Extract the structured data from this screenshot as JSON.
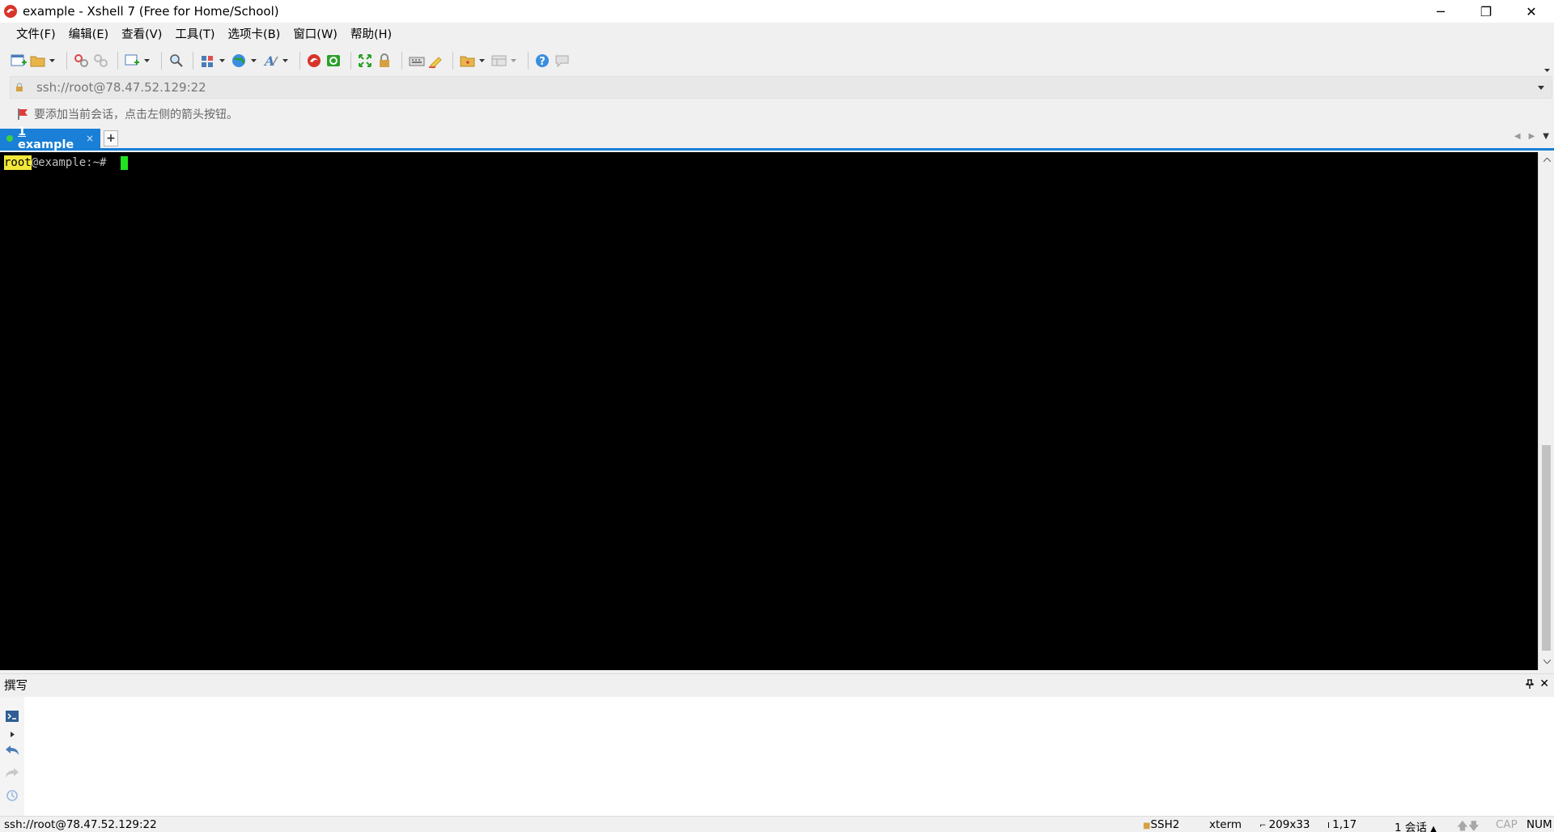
{
  "window": {
    "title": "example - Xshell 7 (Free for Home/School)",
    "icon": "xshell-logo-icon",
    "controls": {
      "minimize": "─",
      "restore": "❐",
      "close": "✕"
    }
  },
  "menu": {
    "items": [
      "文件(F)",
      "编辑(E)",
      "查看(V)",
      "工具(T)",
      "选项卡(B)",
      "窗口(W)",
      "帮助(H)"
    ]
  },
  "address": {
    "value": "ssh://root@78.47.52.129:22"
  },
  "hint": {
    "text": "要添加当前会话，点击左侧的箭头按钮。"
  },
  "tabs": {
    "items": [
      {
        "number": "1",
        "label": " example",
        "close": "×",
        "active": true
      }
    ],
    "add": "+"
  },
  "terminal": {
    "prompt_user": "root",
    "prompt_rest": "@example:~# "
  },
  "compose": {
    "title": "撰写",
    "pin": "📌",
    "close": "✕"
  },
  "status": {
    "address": "ssh://root@78.47.52.129:22",
    "protocol": "SSH2",
    "terminal_type": "xterm",
    "size": "209x33",
    "cursor_pos": "1,17",
    "sessions": "1 会话",
    "cap": "CAP",
    "num": "NUM"
  },
  "colors": {
    "tab_active": "#1a7fd6",
    "terminal_bg": "#000000",
    "prompt_highlight": "#f2e83a",
    "cursor": "#21e321"
  }
}
